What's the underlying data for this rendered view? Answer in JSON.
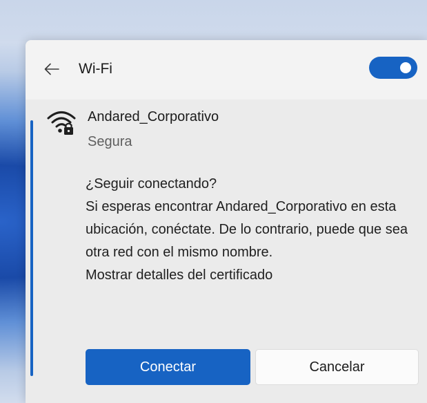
{
  "header": {
    "title": "Wi-Fi",
    "wifi_enabled": true,
    "accent_color": "#1763c3"
  },
  "network": {
    "name": "Andared_Corporativo",
    "security": "Segura",
    "icon": "wifi-secured-icon"
  },
  "prompt": {
    "question": "¿Seguir conectando?",
    "body": "Si esperas encontrar Andared_Corporativo en esta ubicación, conéctate. De lo contrario, puede que sea otra red con el mismo nombre.",
    "cert_link": "Mostrar detalles del certificado"
  },
  "actions": {
    "connect_label": "Conectar",
    "cancel_label": "Cancelar"
  }
}
